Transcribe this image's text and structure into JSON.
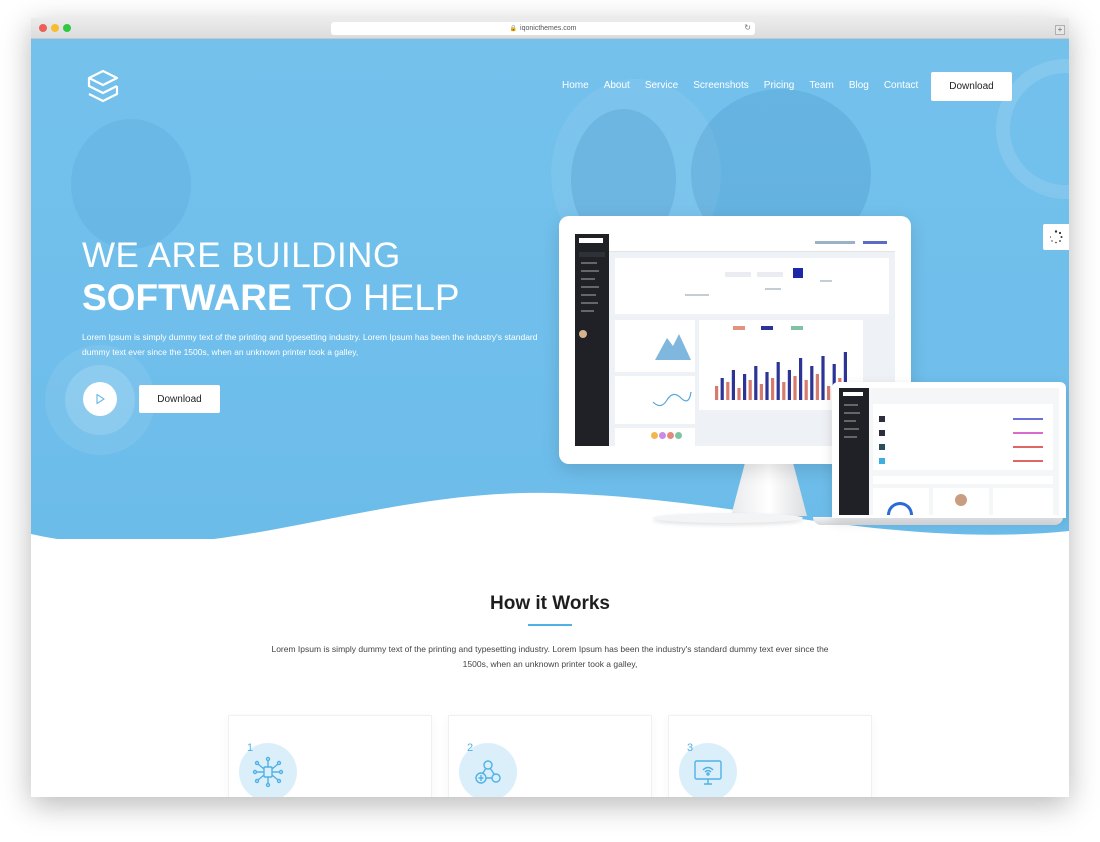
{
  "browser": {
    "url": "iqonicthemes.com",
    "traffic_lights": [
      "#ee5f57",
      "#f8bd2e",
      "#2fc842"
    ]
  },
  "nav": {
    "items": [
      {
        "label": "Home"
      },
      {
        "label": "About"
      },
      {
        "label": "Service"
      },
      {
        "label": "Screenshots"
      },
      {
        "label": "Pricing"
      },
      {
        "label": "Team"
      },
      {
        "label": "Blog"
      },
      {
        "label": "Contact"
      }
    ],
    "download_label": "Download"
  },
  "hero": {
    "title_line1": "WE ARE BUILDING",
    "title_bold": "SOFTWARE",
    "title_rest": "TO HELP",
    "description": "Lorem Ipsum is simply dummy text of the printing and typesetting industry. Lorem Ipsum has been the industry's standard dummy text ever since the 1500s, when an unknown printer took a galley,",
    "download_label": "Download",
    "accent_color": "#6cbcea"
  },
  "how_it_works": {
    "title": "How it Works",
    "description": "Lorem Ipsum is simply dummy text of the printing and typesetting industry. Lorem Ipsum has been the industry's standard dummy text ever since the 1500s, when an unknown printer took a galley,",
    "steps": [
      {
        "number": "1",
        "icon": "network-icon"
      },
      {
        "number": "2",
        "icon": "connection-icon"
      },
      {
        "number": "3",
        "icon": "monitor-wifi-icon"
      }
    ]
  },
  "colors": {
    "hero_bg": "#74c1ec",
    "accent_line": "#4fb1e6",
    "bar_red": "#d77b6d",
    "bar_blue": "#2c3496"
  }
}
